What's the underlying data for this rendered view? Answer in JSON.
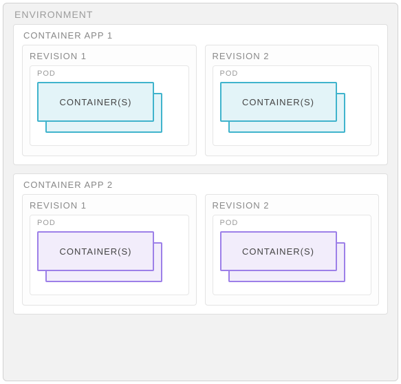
{
  "environment": {
    "label": "ENVIRONMENT",
    "apps": [
      {
        "label": "CONTAINER APP 1",
        "color": "blue",
        "revisions": [
          {
            "label": "REVISION 1",
            "pod_label": "POD",
            "container_label": "CONTAINER(S)"
          },
          {
            "label": "REVISION 2",
            "pod_label": "POD",
            "container_label": "CONTAINER(S)"
          }
        ]
      },
      {
        "label": "CONTAINER APP 2",
        "color": "purple",
        "revisions": [
          {
            "label": "REVISION 1",
            "pod_label": "POD",
            "container_label": "CONTAINER(S)"
          },
          {
            "label": "REVISION 2",
            "pod_label": "POD",
            "container_label": "CONTAINER(S)"
          }
        ]
      }
    ]
  }
}
